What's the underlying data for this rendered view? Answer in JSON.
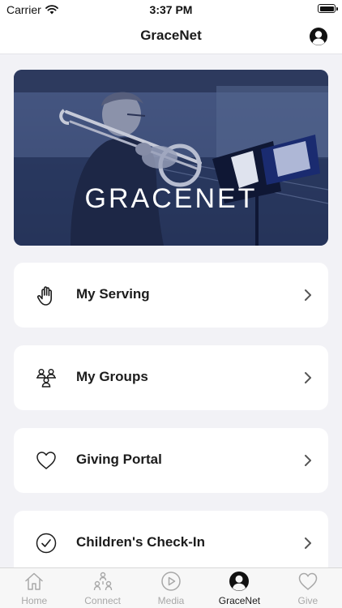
{
  "status_bar": {
    "carrier": "Carrier",
    "time": "3:37 PM",
    "wifi_icon": "wifi-icon",
    "battery_icon": "battery-icon"
  },
  "nav": {
    "title": "GraceNet",
    "profile_icon": "profile-icon"
  },
  "banner": {
    "title": "GRACENET",
    "image": "trombone player performing at church",
    "tint_color": "#2f3f6a"
  },
  "menu": [
    {
      "label": "My Serving",
      "icon": "raised-hand-icon"
    },
    {
      "label": "My Groups",
      "icon": "group-people-icon"
    },
    {
      "label": "Giving Portal",
      "icon": "heart-icon"
    },
    {
      "label": "Children's Check-In",
      "icon": "check-circle-icon"
    }
  ],
  "tabs": [
    {
      "label": "Home",
      "icon": "home-icon",
      "active": false
    },
    {
      "label": "Connect",
      "icon": "connect-icon",
      "active": false
    },
    {
      "label": "Media",
      "icon": "play-icon",
      "active": false
    },
    {
      "label": "GraceNet",
      "icon": "profile-icon",
      "active": true
    },
    {
      "label": "Give",
      "icon": "heart-icon",
      "active": false
    }
  ],
  "colors": {
    "background": "#f2f2f6",
    "card": "#ffffff",
    "text": "#1c1c1c",
    "inactive_tab": "#a8a8a8",
    "banner": "#2f3f6a"
  }
}
